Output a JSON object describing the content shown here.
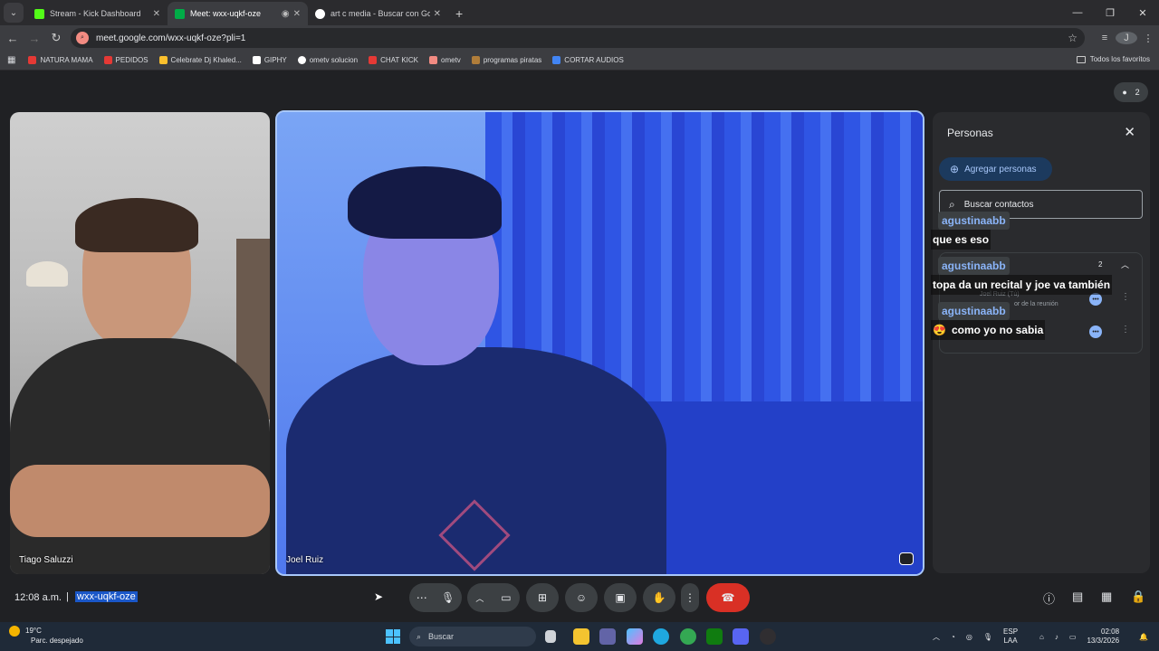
{
  "browser": {
    "tabs": [
      {
        "title": "Stream - Kick Dashboard",
        "color": "#53fc18",
        "active": false
      },
      {
        "title": "Meet: wxx-uqkf-oze",
        "color": "#00ac47",
        "active": true
      },
      {
        "title": "art c media - Buscar con Google",
        "color": "#ffffff",
        "active": false
      }
    ],
    "url": "meet.google.com/wxx-uqkf-oze?pli=1",
    "profile_initial": "J",
    "bookmarks": [
      {
        "label": "NATURA MAMA",
        "color": "#e53935"
      },
      {
        "label": "PEDIDOS",
        "color": "#e53935"
      },
      {
        "label": "Celebrate Dj Khaled...",
        "color": "#fbc02d"
      },
      {
        "label": "GIPHY",
        "color": "#ffffff"
      },
      {
        "label": "ometv solucion",
        "color": "#ffffff"
      },
      {
        "label": "CHAT KICK",
        "color": "#e53935"
      },
      {
        "label": "ometv",
        "color": "#f28b82"
      },
      {
        "label": "programas piratas",
        "color": "#b07d3a"
      },
      {
        "label": "CORTAR AUDIOS",
        "color": "#4285f4"
      }
    ],
    "all_bookmarks": "Todos los favoritos"
  },
  "meet": {
    "participant_count": "2",
    "tiles": [
      {
        "name": "Tiago Saluzzi"
      },
      {
        "name": "Joel Ruiz"
      }
    ],
    "people_panel": {
      "title": "Personas",
      "add_label": "Agregar personas",
      "search_placeholder": "Buscar contactos",
      "count": "2",
      "row1_name": "Joel Ruiz (Tú)",
      "row1_role": "or de la reunión"
    },
    "chat_overlay": [
      {
        "user": "agustinaabb",
        "message": "que es eso"
      },
      {
        "user": "agustinaabb",
        "message": "topa da un recital y joe va también"
      },
      {
        "user": "agustinaabb",
        "message": "como yo no sabia"
      }
    ],
    "bottom": {
      "time": "12:08 a.m.",
      "separator": "|",
      "meeting_code": "wxx-uqkf-oze"
    }
  },
  "taskbar": {
    "weather_temp": "19°C",
    "weather_desc": "Parc. despejado",
    "search_label": "Buscar",
    "lang_1": "ESP",
    "lang_2": "LAA",
    "time": "02:08",
    "date": "13/3/2026"
  }
}
